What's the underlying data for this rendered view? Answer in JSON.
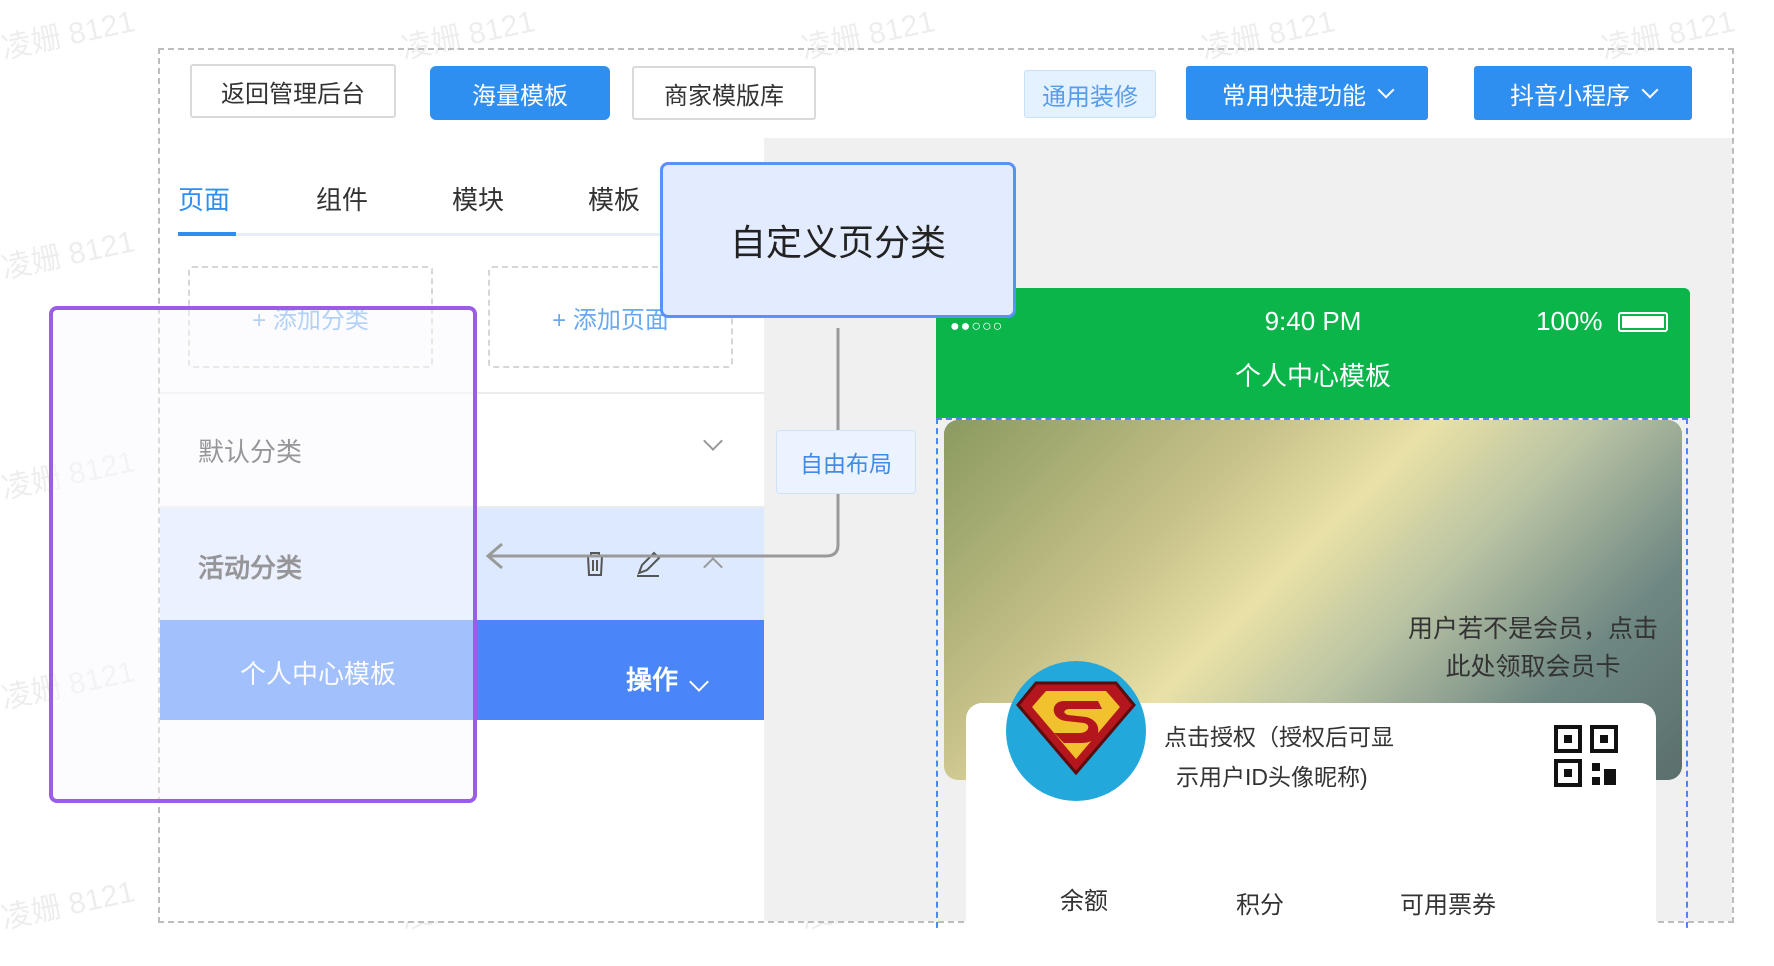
{
  "toolbar": {
    "back_label": "返回管理后台",
    "massive_templates_label": "海量模板",
    "merchant_library_label": "商家模版库",
    "general_decoration_label": "通用装修",
    "shortcuts_label": "常用快捷功能",
    "douyin_label": "抖音小程序"
  },
  "tabs": [
    "页面",
    "组件",
    "模块",
    "模板"
  ],
  "active_tab_index": 0,
  "add_category_label": "+ 添加分类",
  "add_page_label": "+ 添加页面",
  "categories": {
    "default": "默认分类",
    "activity": "活动分类"
  },
  "selected_page": {
    "label": "个人中心模板",
    "action_label": "操作"
  },
  "callout": {
    "text": "自定义页分类"
  },
  "free_layout_label": "自由布局",
  "phone": {
    "time": "9:40 PM",
    "battery": "100%",
    "title": "个人中心模板",
    "member_hint_line1": "用户若不是会员，点击",
    "member_hint_line2": "此处领取会员卡",
    "auth_line1": "点击授权（授权后可显",
    "auth_line2": "示用户ID头像昵称)",
    "stats": [
      "余额",
      "积分",
      "可用票券"
    ]
  },
  "watermark_text": "凌姗 8121",
  "colors": {
    "primary": "#2f8ff0",
    "selected_row": "#4a86f7",
    "activity_row": "#dce9ff",
    "phone_status": "#0ab54a",
    "callout_border": "#5b8ff9",
    "highlight_border": "#9b5de5"
  }
}
